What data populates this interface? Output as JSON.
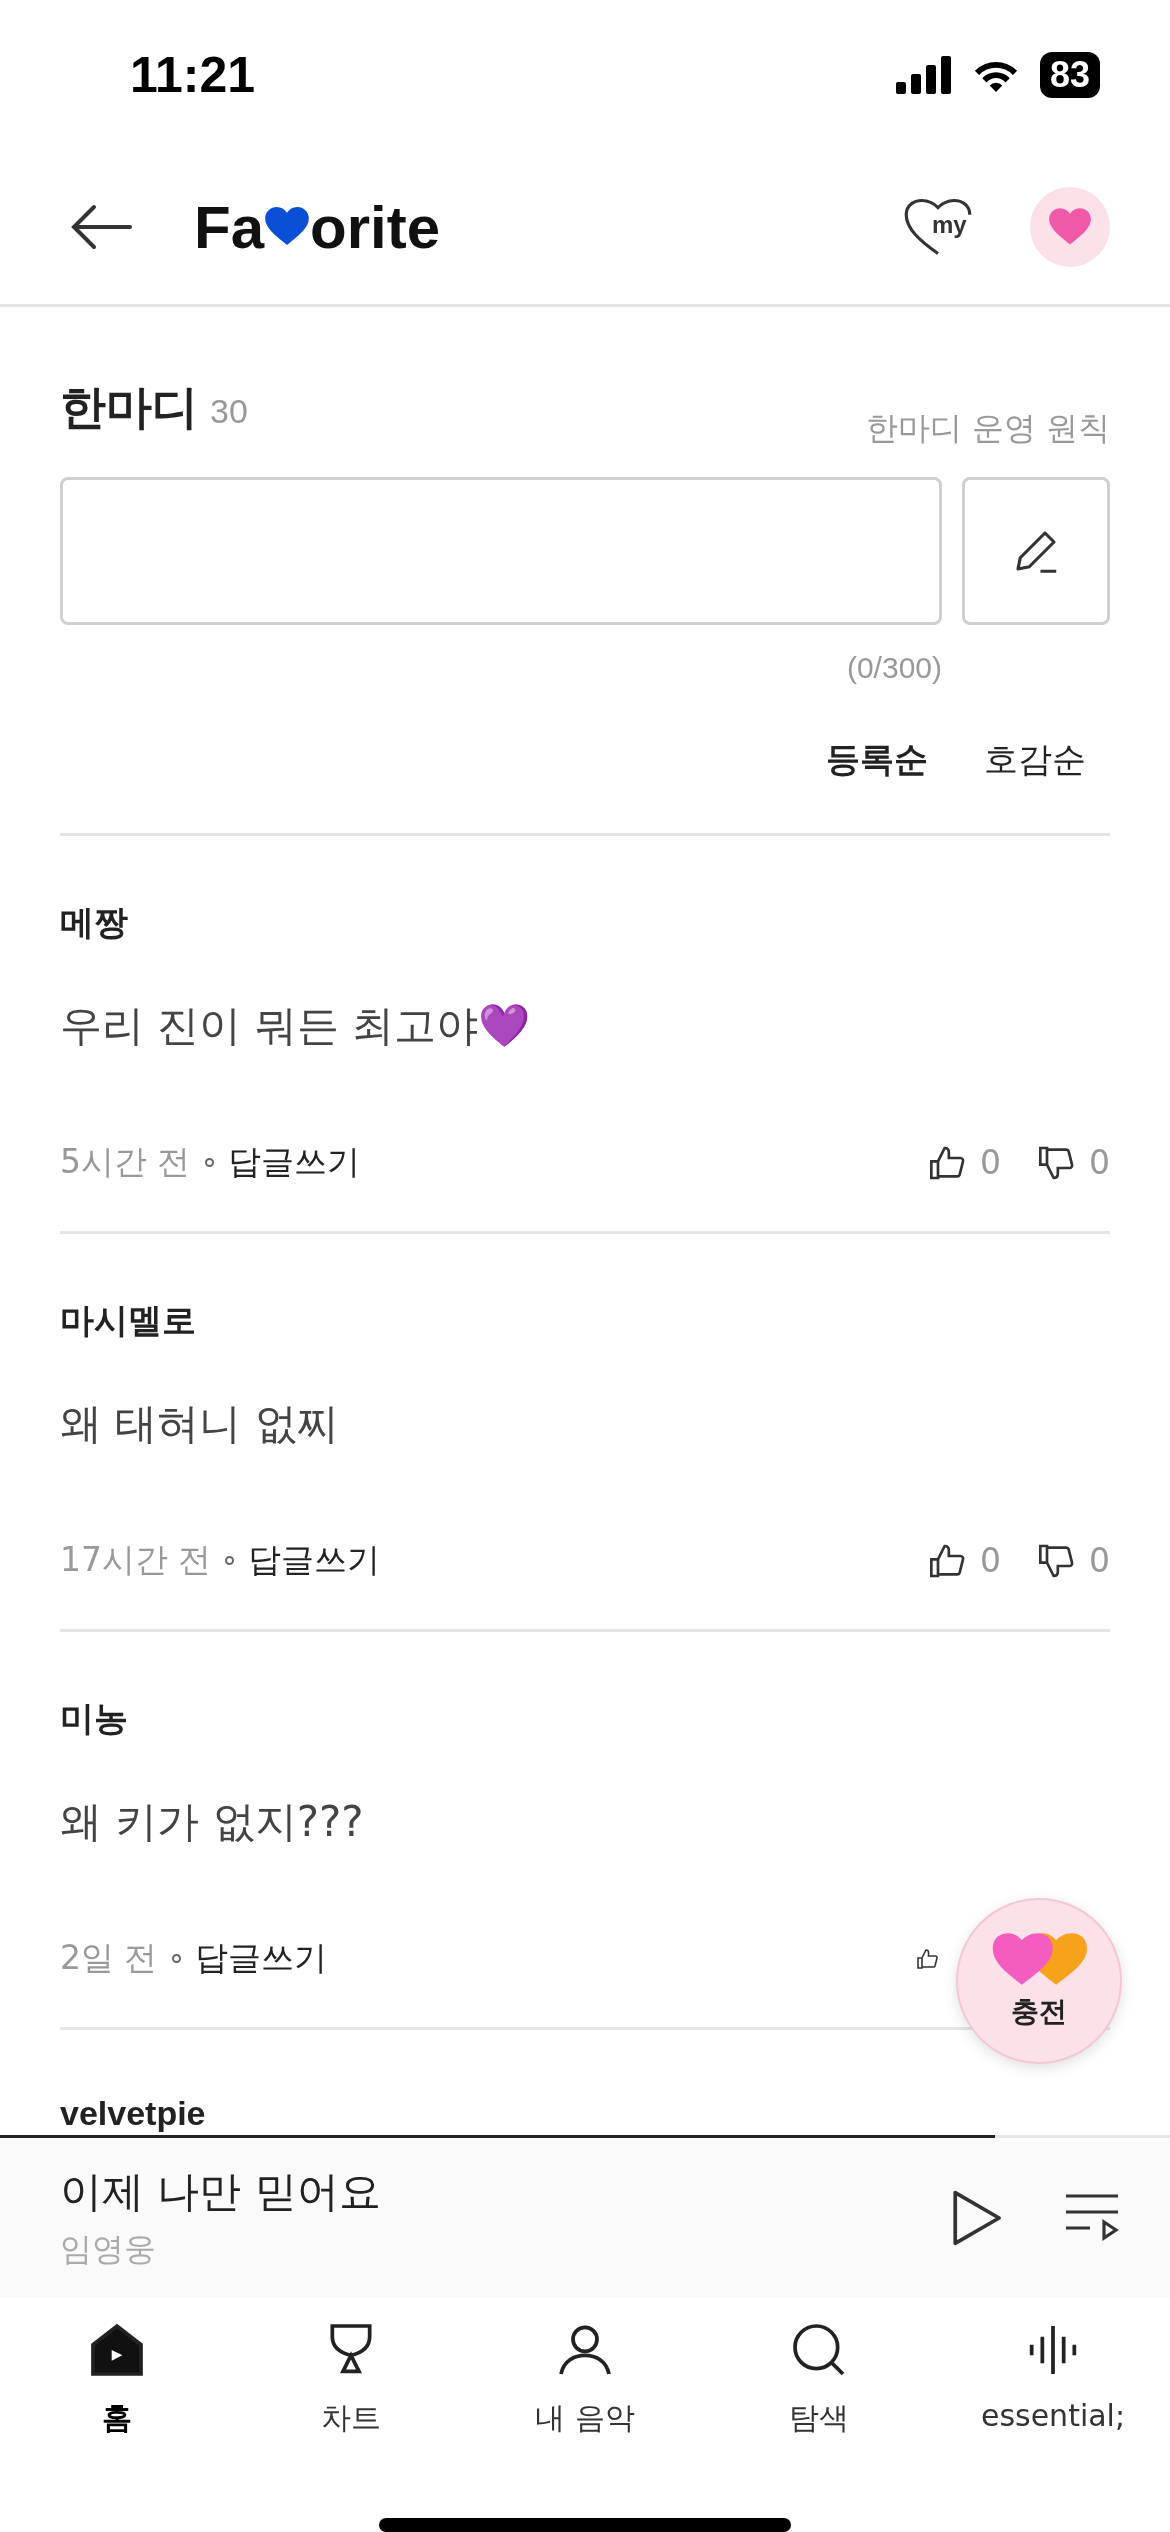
{
  "status_bar": {
    "time": "11:21",
    "battery": "83"
  },
  "header": {
    "title_start": "Fa",
    "title_end": "orite",
    "my_label": "my"
  },
  "section": {
    "title": "한마디",
    "count": "30",
    "rules_link": "한마디 운영 원칙",
    "char_count": "(0/300)"
  },
  "sort_options": [
    {
      "label": "등록순",
      "selected": true
    },
    {
      "label": "호감순",
      "selected": false
    }
  ],
  "comments": [
    {
      "author": "메짱",
      "text": "우리 진이 뭐든 최고야💜",
      "time": "5시간 전",
      "reply": "답글쓰기",
      "likes": "0",
      "dislikes": "0"
    },
    {
      "author": "마시멜로",
      "text": "왜 태혀니 없찌",
      "time": "17시간 전",
      "reply": "답글쓰기",
      "likes": "0",
      "dislikes": "0"
    },
    {
      "author": "미농",
      "text": "왜 키가 없지???",
      "time": "2일 전",
      "reply": "답글쓰기"
    },
    {
      "author": "velvetpie"
    }
  ],
  "charge_button": {
    "label": "충전"
  },
  "mini_player": {
    "title": "이제 나만 믿어요",
    "artist": "임영웅",
    "level": 0.85
  },
  "tabs": [
    {
      "kind": "home",
      "label": "홈",
      "selected": true
    },
    {
      "kind": "chart",
      "label": "차트",
      "selected": false
    },
    {
      "kind": "my",
      "label": "내 음악",
      "selected": false
    },
    {
      "kind": "search",
      "label": "탐색",
      "selected": false
    },
    {
      "kind": "wave",
      "label": "essential;",
      "selected": false
    }
  ]
}
